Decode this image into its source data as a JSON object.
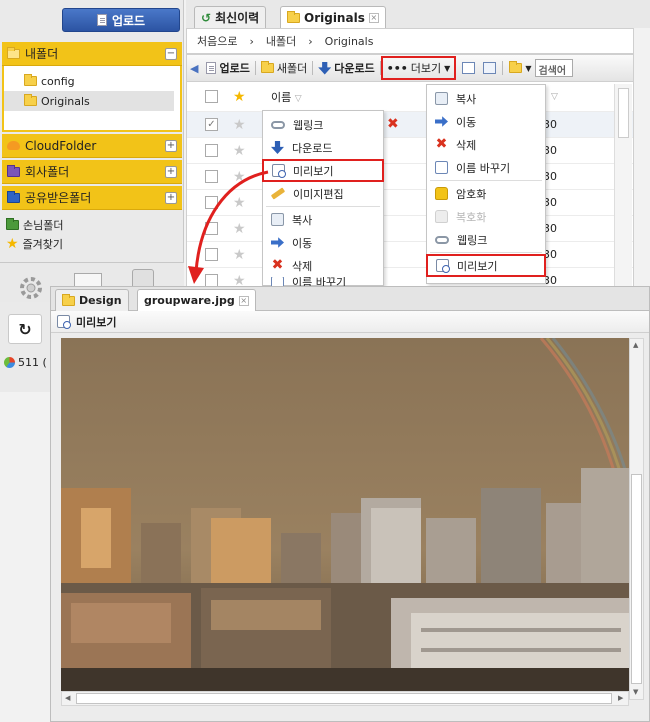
{
  "sidebar": {
    "upload_label": "업로드",
    "my_folder": "내폴더",
    "tree": [
      {
        "label": "config"
      },
      {
        "label": "Originals"
      }
    ],
    "cloud_folder": "CloudFolder",
    "company_folder": "회사폴더",
    "shared_folder": "공유받은폴더",
    "guest_folder": "손님폴더",
    "favorites": "즐겨찾기",
    "status_text": "511 ("
  },
  "tabs": [
    {
      "label": "최신이력"
    },
    {
      "label": "Originals"
    }
  ],
  "breadcrumb": [
    "처음으로",
    "내폴더",
    "Originals"
  ],
  "toolbar": {
    "upload": "업로드",
    "new_folder": "새폴더",
    "download": "다운로드",
    "more": "더보기",
    "search_placeholder": "검색어"
  },
  "list": {
    "header_name": "이름",
    "rows": [
      {
        "size": "30"
      },
      {
        "size": "30"
      },
      {
        "size": "30"
      },
      {
        "size": "30"
      },
      {
        "size": "30"
      },
      {
        "size": "30"
      },
      {
        "size": "30"
      }
    ]
  },
  "context_menu": {
    "items": [
      "웹링크",
      "다운로드",
      "미리보기",
      "이미지편집",
      "복사",
      "이동",
      "삭제",
      "이름 바꾸기"
    ]
  },
  "more_menu": {
    "items": [
      "복사",
      "이동",
      "삭제",
      "이름 바꾸기",
      "암호화",
      "복호화",
      "웹링크",
      "미리보기"
    ]
  },
  "preview": {
    "tabs": [
      {
        "label": "Design"
      },
      {
        "label": "groupware.jpg"
      }
    ],
    "title": "미리보기"
  },
  "colors": {
    "highlight": "#e0201e",
    "folder_yellow": "#f2c318",
    "upload_blue": "#2c54a3"
  }
}
